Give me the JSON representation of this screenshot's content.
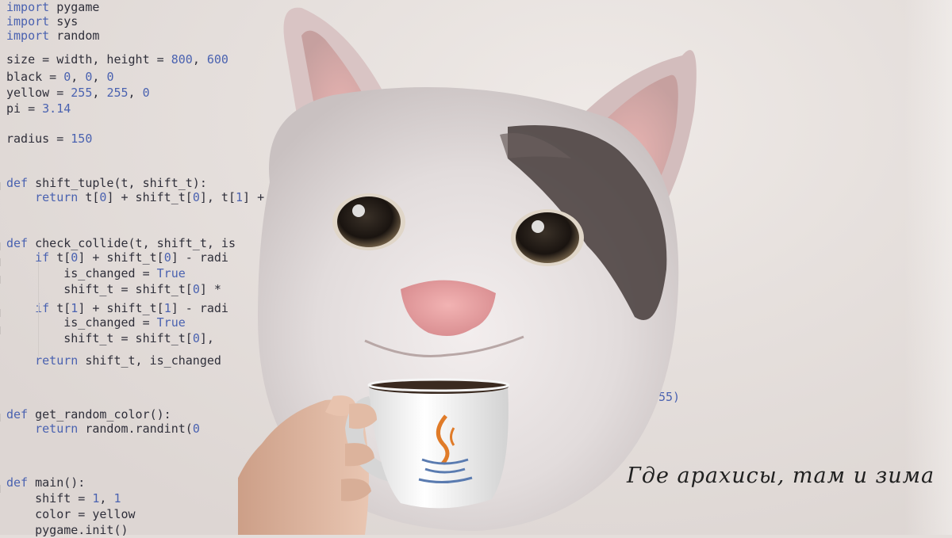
{
  "code_lines": [
    {
      "segments": [
        {
          "t": "import",
          "c": "kw"
        },
        {
          "t": " pygame"
        }
      ]
    },
    {
      "segments": [
        {
          "t": "import",
          "c": "kw"
        },
        {
          "t": " sys"
        }
      ]
    },
    {
      "segments": [
        {
          "t": "import",
          "c": "kw"
        },
        {
          "t": " random"
        }
      ]
    },
    {
      "segments": [
        {
          "t": "size = width, height = "
        },
        {
          "t": "800",
          "c": "num"
        },
        {
          "t": ", "
        },
        {
          "t": "600",
          "c": "num"
        }
      ]
    },
    {
      "segments": [
        {
          "t": "black = "
        },
        {
          "t": "0",
          "c": "num"
        },
        {
          "t": ", "
        },
        {
          "t": "0",
          "c": "num"
        },
        {
          "t": ", "
        },
        {
          "t": "0",
          "c": "num"
        }
      ]
    },
    {
      "segments": [
        {
          "t": "yellow = "
        },
        {
          "t": "255",
          "c": "num"
        },
        {
          "t": ", "
        },
        {
          "t": "255",
          "c": "num"
        },
        {
          "t": ", "
        },
        {
          "t": "0",
          "c": "num"
        }
      ]
    },
    {
      "segments": [
        {
          "t": "pi = "
        },
        {
          "t": "3.14",
          "c": "num"
        }
      ]
    },
    {
      "segments": [
        {
          "t": "radius = "
        },
        {
          "t": "150",
          "c": "num"
        }
      ]
    },
    {
      "segments": [
        {
          "t": "def",
          "c": "kw"
        },
        {
          "t": " shift_tuple(t, shift_t):"
        }
      ]
    },
    {
      "segments": [
        {
          "t": "    "
        },
        {
          "t": "return",
          "c": "kw"
        },
        {
          "t": " t["
        },
        {
          "t": "0",
          "c": "num"
        },
        {
          "t": "] + shift_t["
        },
        {
          "t": "0",
          "c": "num"
        },
        {
          "t": "], t["
        },
        {
          "t": "1",
          "c": "num"
        },
        {
          "t": "] +"
        }
      ]
    },
    {
      "segments": [
        {
          "t": "def",
          "c": "kw"
        },
        {
          "t": " check_collide(t, shift_t, is"
        }
      ]
    },
    {
      "segments": [
        {
          "t": "    "
        },
        {
          "t": "if",
          "c": "kw"
        },
        {
          "t": " t["
        },
        {
          "t": "0",
          "c": "num"
        },
        {
          "t": "] + shift_t["
        },
        {
          "t": "0",
          "c": "num"
        },
        {
          "t": "] - radi"
        }
      ]
    },
    {
      "segments": [
        {
          "t": "        is_changed = "
        },
        {
          "t": "True",
          "c": "kw"
        }
      ]
    },
    {
      "segments": [
        {
          "t": "        shift_t = shift_t["
        },
        {
          "t": "0",
          "c": "num"
        },
        {
          "t": "] *"
        }
      ]
    },
    {
      "segments": [
        {
          "t": "    "
        },
        {
          "t": "if",
          "c": "kw"
        },
        {
          "t": " t["
        },
        {
          "t": "1",
          "c": "num"
        },
        {
          "t": "] + shift_t["
        },
        {
          "t": "1",
          "c": "num"
        },
        {
          "t": "] - radi"
        }
      ]
    },
    {
      "segments": [
        {
          "t": "        is_changed = "
        },
        {
          "t": "True",
          "c": "kw"
        }
      ]
    },
    {
      "segments": [
        {
          "t": "        shift_t = shift_t["
        },
        {
          "t": "0",
          "c": "num"
        },
        {
          "t": "],"
        }
      ]
    },
    {
      "segments": [
        {
          "t": "    "
        },
        {
          "t": "return",
          "c": "kw"
        },
        {
          "t": " shift_t, is_changed"
        }
      ]
    },
    {
      "segments": [
        {
          "t": "def",
          "c": "kw"
        },
        {
          "t": " get_random_color():"
        }
      ]
    },
    {
      "segments": [
        {
          "t": "    "
        },
        {
          "t": "return",
          "c": "kw"
        },
        {
          "t": " random.randint("
        },
        {
          "t": "0",
          "c": "num"
        }
      ]
    },
    {
      "segments": [
        {
          "t": "def",
          "c": "kw"
        },
        {
          "t": " main():"
        }
      ]
    },
    {
      "segments": [
        {
          "t": "    shift = "
        },
        {
          "t": "1",
          "c": "num"
        },
        {
          "t": ", "
        },
        {
          "t": "1",
          "c": "num"
        }
      ]
    },
    {
      "segments": [
        {
          "t": "    color = yellow"
        }
      ]
    },
    {
      "segments": [
        {
          "t": "    pygame.init()"
        }
      ]
    },
    {
      "segments": [
        {
          "t": "55)",
          "c": "num"
        }
      ]
    }
  ],
  "caption": "Где арахисы, там и зима",
  "colors": {
    "keyword": "#4a62b0",
    "code": "#2f2f3a",
    "background": "#e4dedb"
  },
  "image": {
    "subject": "cat-holding-java-coffee-cup",
    "cup_logo": "java-logo-icon"
  }
}
